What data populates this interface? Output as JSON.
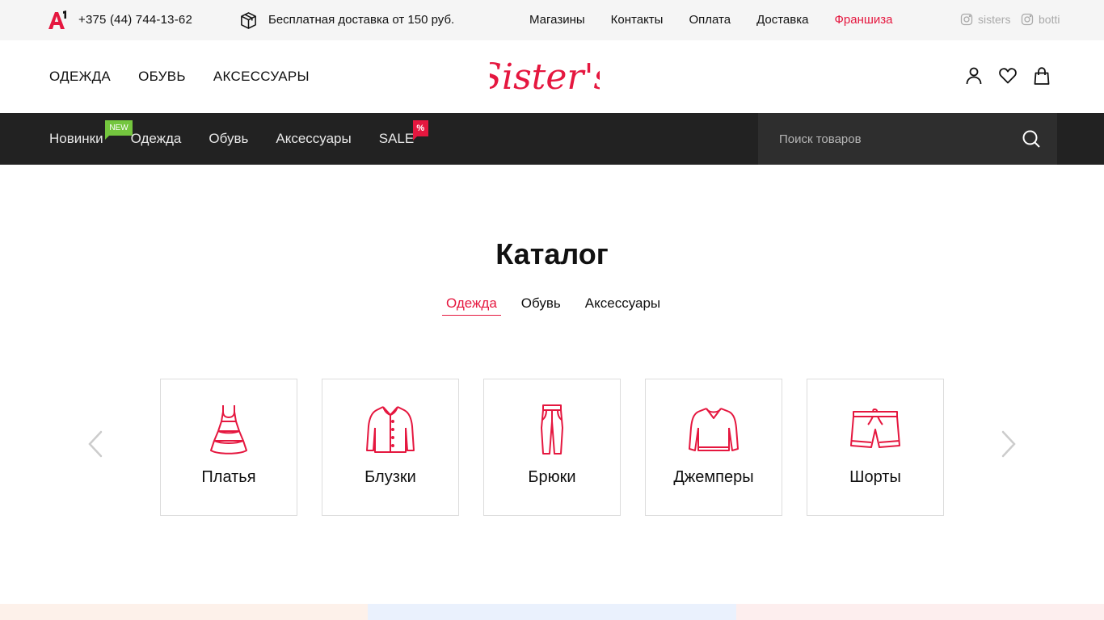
{
  "topbar": {
    "phone": "+375 (44) 744-13-62",
    "delivery": "Бесплатная доставка от 150 руб.",
    "links": [
      {
        "label": "Магазины",
        "accent": false
      },
      {
        "label": "Контакты",
        "accent": false
      },
      {
        "label": "Оплата",
        "accent": false
      },
      {
        "label": "Доставка",
        "accent": false
      },
      {
        "label": "Франшиза",
        "accent": true
      }
    ],
    "social": [
      {
        "label": "sisters",
        "icon": "instagram-icon"
      },
      {
        "label": "botti",
        "icon": "instagram-icon"
      }
    ]
  },
  "header": {
    "categories": [
      "ОДЕЖДА",
      "ОБУВЬ",
      "АКСЕССУАРЫ"
    ],
    "logo_text": "Sister's",
    "icons": [
      "user-icon",
      "heart-icon",
      "bag-icon"
    ]
  },
  "nav": {
    "items": [
      {
        "label": "Новинки",
        "badge": "NEW"
      },
      {
        "label": "Одежда"
      },
      {
        "label": "Обувь"
      },
      {
        "label": "Аксессуары"
      },
      {
        "label": "SALE",
        "badge": "%"
      }
    ],
    "search_placeholder": "Поиск товаров"
  },
  "catalog": {
    "title": "Каталог",
    "tabs": [
      {
        "label": "Одежда",
        "active": true
      },
      {
        "label": "Обувь",
        "active": false
      },
      {
        "label": "Аксессуары",
        "active": false
      }
    ],
    "cards": [
      {
        "label": "Платья",
        "icon": "dress-icon"
      },
      {
        "label": "Блузки",
        "icon": "blouse-icon"
      },
      {
        "label": "Брюки",
        "icon": "trousers-icon"
      },
      {
        "label": "Джемперы",
        "icon": "jumper-icon"
      },
      {
        "label": "Шорты",
        "icon": "shorts-icon"
      }
    ]
  },
  "colors": {
    "accent": "#e5173f",
    "nav_bg": "#222222",
    "new_badge": "#74c63e",
    "topbar_bg": "#f5f5f5"
  }
}
